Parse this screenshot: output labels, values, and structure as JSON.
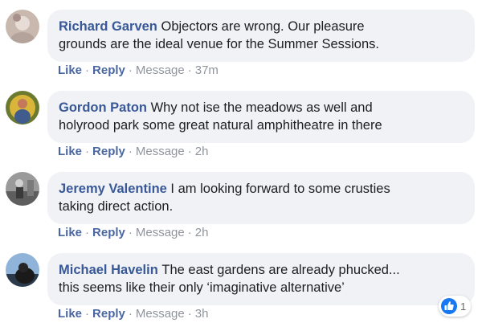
{
  "colors": {
    "bubble": "#f0f2f5",
    "author": "#385898",
    "link": "#4b67a1",
    "meta": "#90949c",
    "like_blue": "#1877f2"
  },
  "comments": [
    {
      "author": "Richard Garven",
      "text_line1": "Objectors are wrong. Our pleasure",
      "text_line2": "grounds are the ideal venue for the Summer Sessions.",
      "like": "Like",
      "reply": "Reply",
      "message": "Message",
      "time": "37m",
      "avatar_icon": "user-photo-icon"
    },
    {
      "author": "Gordon Paton",
      "text_line1": "Why not ise the meadows as well and",
      "text_line2": "holyrood park some great natural amphitheatre in there",
      "like": "Like",
      "reply": "Reply",
      "message": "Message",
      "time": "2h",
      "avatar_icon": "user-photo-icon"
    },
    {
      "author": "Jeremy Valentine",
      "text_line1": "I am looking forward to some crusties",
      "text_line2": "taking direct action.",
      "like": "Like",
      "reply": "Reply",
      "message": "Message",
      "time": "2h",
      "avatar_icon": "user-photo-icon"
    },
    {
      "author": "Michael Havelin",
      "text_line1": "The east gardens are already phucked...",
      "text_line2": "this seems like their only ‘imaginative alternative’",
      "like": "Like",
      "reply": "Reply",
      "message": "Message",
      "time": "3h",
      "avatar_icon": "user-photo-icon"
    }
  ],
  "reaction": {
    "icon": "like-thumb-icon",
    "count": "1"
  }
}
